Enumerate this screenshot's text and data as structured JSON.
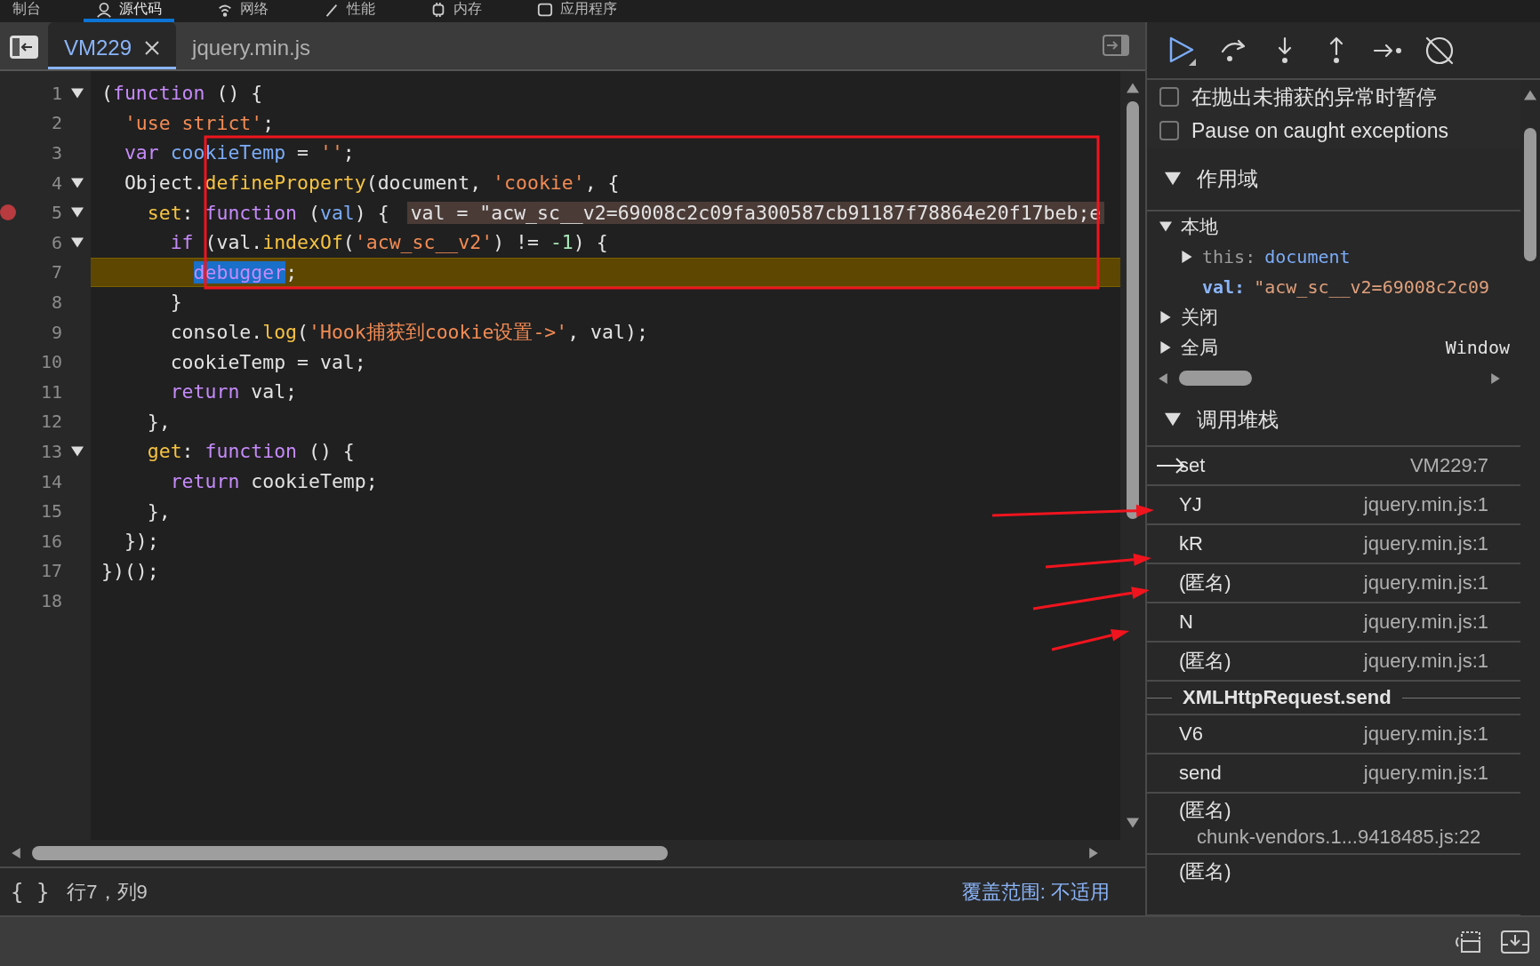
{
  "top_tabs": [
    {
      "label": "制台",
      "selected": false
    },
    {
      "label": "源代码",
      "selected": true
    },
    {
      "label": "网络",
      "selected": false
    },
    {
      "label": "性能",
      "selected": false
    },
    {
      "label": "内存",
      "selected": false
    },
    {
      "label": "应用程序",
      "selected": false
    }
  ],
  "file_tabs": [
    {
      "label": "VM229",
      "selected": true
    },
    {
      "label": "jquery.min.js",
      "selected": false
    }
  ],
  "code": [
    {
      "number": "1",
      "expanded": true,
      "tokens": [
        {
          "t": "(",
          "kind": "plain"
        },
        {
          "t": "function",
          "kind": "keyword"
        },
        {
          "t": " () {",
          "kind": "plain"
        }
      ]
    },
    {
      "number": "2",
      "tokens": [
        {
          "t": "  'use strict'",
          "kind": "string"
        },
        {
          "t": ";",
          "kind": "plain"
        }
      ]
    },
    {
      "number": "3",
      "tokens": [
        {
          "t": "  var ",
          "kind": "keyword"
        },
        {
          "t": "cookieTemp",
          "kind": "variable"
        },
        {
          "t": " = ",
          "kind": "plain"
        },
        {
          "t": "''",
          "kind": "string"
        },
        {
          "t": ";",
          "kind": "plain"
        }
      ]
    },
    {
      "number": "4",
      "expanded": true,
      "tokens": [
        {
          "t": "  Object.",
          "kind": "plain"
        },
        {
          "t": "defineProperty",
          "kind": "function"
        },
        {
          "t": "(document, ",
          "kind": "plain"
        },
        {
          "t": "'cookie'",
          "kind": "string"
        },
        {
          "t": ", {",
          "kind": "plain"
        }
      ]
    },
    {
      "number": "5",
      "expanded": true,
      "breakpoint": true,
      "tokens": [
        {
          "t": "    set",
          "kind": "function"
        },
        {
          "t": ": ",
          "kind": "plain"
        },
        {
          "t": "function",
          "kind": "keyword"
        },
        {
          "t": " (",
          "kind": "plain"
        },
        {
          "t": "val",
          "kind": "variable"
        },
        {
          "t": ") {",
          "kind": "plain"
        }
      ],
      "inline_value": "val = \"acw_sc__v2=69008c2c09fa300587cb91187f78864e20f17beb;e"
    },
    {
      "number": "6",
      "expanded": true,
      "tokens": [
        {
          "t": "      if",
          "kind": "keyword"
        },
        {
          "t": " (val.",
          "kind": "plain"
        },
        {
          "t": "indexOf",
          "kind": "function"
        },
        {
          "t": "(",
          "kind": "plain"
        },
        {
          "t": "'acw_sc__v2'",
          "kind": "string"
        },
        {
          "t": ") != ",
          "kind": "plain"
        },
        {
          "t": "-1",
          "kind": "number"
        },
        {
          "t": ") {",
          "kind": "plain"
        }
      ]
    },
    {
      "number": "7",
      "paused": true,
      "tokens": [
        {
          "t": "        debugger",
          "kind": "selection"
        },
        {
          "t": ";",
          "kind": "plain"
        }
      ]
    },
    {
      "number": "8",
      "tokens": [
        {
          "t": "      }",
          "kind": "plain"
        }
      ]
    },
    {
      "number": "9",
      "tokens": [
        {
          "t": "      console.",
          "kind": "plain"
        },
        {
          "t": "log",
          "kind": "function"
        },
        {
          "t": "(",
          "kind": "plain"
        },
        {
          "t": "'Hook捕获到cookie设置->'",
          "kind": "string"
        },
        {
          "t": ", val);",
          "kind": "plain"
        }
      ]
    },
    {
      "number": "10",
      "tokens": [
        {
          "t": "      cookieTemp = val;",
          "kind": "plain"
        }
      ]
    },
    {
      "number": "11",
      "tokens": [
        {
          "t": "      return",
          "kind": "keyword"
        },
        {
          "t": " val;",
          "kind": "plain"
        }
      ]
    },
    {
      "number": "12",
      "tokens": [
        {
          "t": "    },",
          "kind": "plain"
        }
      ]
    },
    {
      "number": "13",
      "expanded": true,
      "tokens": [
        {
          "t": "    get",
          "kind": "function"
        },
        {
          "t": ": ",
          "kind": "plain"
        },
        {
          "t": "function",
          "kind": "keyword"
        },
        {
          "t": " () {",
          "kind": "plain"
        }
      ]
    },
    {
      "number": "14",
      "tokens": [
        {
          "t": "      return",
          "kind": "keyword"
        },
        {
          "t": " cookieTemp;",
          "kind": "plain"
        }
      ]
    },
    {
      "number": "15",
      "tokens": [
        {
          "t": "    },",
          "kind": "plain"
        }
      ]
    },
    {
      "number": "16",
      "tokens": [
        {
          "t": "  });",
          "kind": "plain"
        }
      ]
    },
    {
      "number": "17",
      "tokens": [
        {
          "t": "})();",
          "kind": "plain"
        }
      ]
    },
    {
      "number": "18"
    }
  ],
  "status_bar": {
    "format_icon": "{ }",
    "position": "行7，列9",
    "coverage": "覆盖范围: 不适用"
  },
  "exception_options": [
    {
      "label": "在抛出未捕获的异常时暂停",
      "checked": false
    },
    {
      "label": "Pause on caught exceptions",
      "checked": false
    }
  ],
  "scope": {
    "title": "作用域",
    "expanded": true,
    "items": [
      {
        "label": "本地",
        "expanded": true,
        "children": [
          {
            "key": "this:",
            "value": "document",
            "expanded": false,
            "kind": "object"
          },
          {
            "key": "val:",
            "value": "\"acw_sc__v2=69008c2c09",
            "kind": "string"
          }
        ]
      },
      {
        "label": "关闭",
        "expanded": false
      },
      {
        "label": "全局",
        "expanded": false,
        "value": "Window"
      }
    ]
  },
  "call_stack": {
    "title": "调用堆栈",
    "expanded": true,
    "frames": [
      {
        "kind": "frame",
        "name": "set",
        "location": "VM229:7",
        "current": true
      },
      {
        "kind": "frame",
        "name": "YJ",
        "location": "jquery.min.js:1",
        "current": false
      },
      {
        "kind": "frame",
        "name": "kR",
        "location": "jquery.min.js:1",
        "current": false
      },
      {
        "kind": "frame",
        "name": "(匿名)",
        "location": "jquery.min.js:1",
        "current": false
      },
      {
        "kind": "frame",
        "name": "N",
        "location": "jquery.min.js:1",
        "current": false
      },
      {
        "kind": "frame",
        "name": "(匿名)",
        "location": "jquery.min.js:1",
        "current": false
      },
      {
        "kind": "async",
        "name": "XMLHttpRequest.send"
      },
      {
        "kind": "frame",
        "name": "V6",
        "location": "jquery.min.js:1",
        "current": false
      },
      {
        "kind": "frame",
        "name": "send",
        "location": "jquery.min.js:1",
        "current": false
      },
      {
        "kind": "wrapped",
        "name": "(匿名)",
        "location": "chunk-vendors.1...9418485.js:22"
      },
      {
        "kind": "wrapped",
        "name": "(匿名)"
      }
    ]
  }
}
